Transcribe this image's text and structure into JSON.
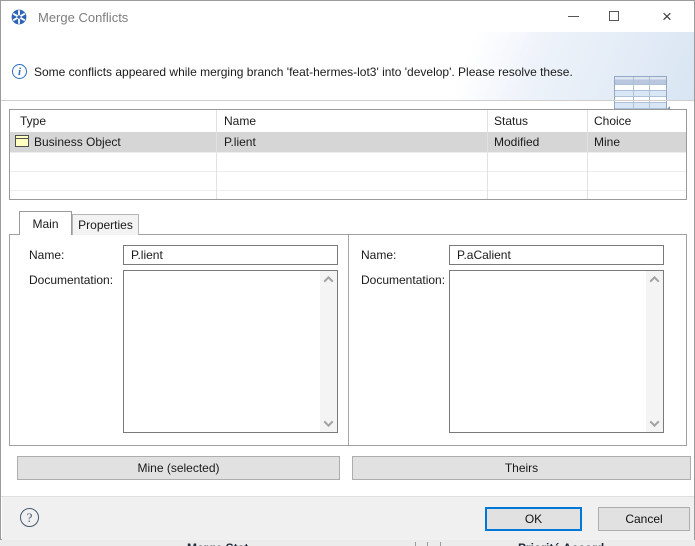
{
  "window": {
    "title": "Merge Conflicts"
  },
  "icons": {
    "close": "×",
    "info": "i",
    "help": "?"
  },
  "banner": {
    "message": "Some conflicts appeared while merging branch 'feat-hermes-lot3' into 'develop'. Please resolve these."
  },
  "conflict_table": {
    "columns": [
      "Type",
      "Name",
      "Status",
      "Choice"
    ],
    "rows": [
      {
        "type": "Business Object",
        "name": "P.lient",
        "status": "Modified",
        "choice": "Mine",
        "selected": true
      }
    ]
  },
  "tabs": [
    {
      "label": "Main",
      "active": true
    },
    {
      "label": "Properties",
      "active": false
    }
  ],
  "mine_panel": {
    "name_label": "Name:",
    "name_value": "P.lient",
    "documentation_label": "Documentation:",
    "documentation_value": "",
    "button_label": "Mine (selected)"
  },
  "theirs_panel": {
    "name_label": "Name:",
    "name_value": "P.aCalient",
    "documentation_label": "Documentation:",
    "documentation_value": "",
    "button_label": "Theirs"
  },
  "footer": {
    "ok_label": "OK",
    "cancel_label": "Cancel"
  },
  "background_fragments": {
    "left_text": "Merge Stat",
    "right_text": "Priorité  Accord"
  },
  "colors": {
    "accent_blue": "#0078d7",
    "selected_row": "#d6d6d6",
    "info_blue": "#2a6fc0"
  }
}
